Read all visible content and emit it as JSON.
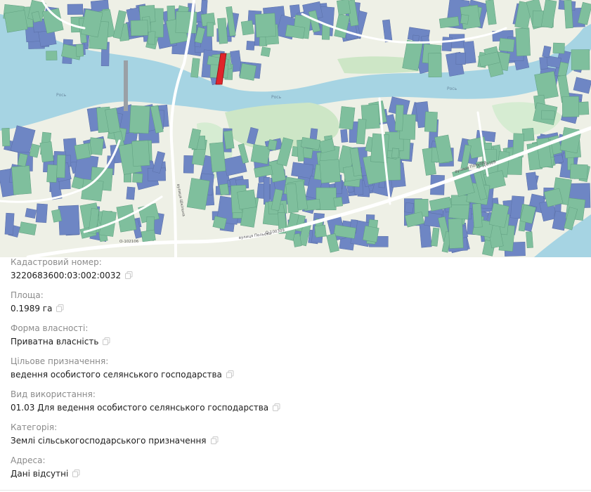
{
  "map": {
    "river_labels": [
      "Рось",
      "Рось",
      "Рось"
    ],
    "road_labels": [
      "О-102106",
      "вулиця Польова",
      "О-100309",
      "вулиця Польова",
      "О-100309",
      "вулиця Шкільна"
    ],
    "colors": {
      "water": "#a6d4e3",
      "land": "#eef0e6",
      "parcel_blue": "#6e86c4",
      "parcel_green": "#7fbf9d",
      "selected_parcel": "#e0242a",
      "park": "#cde6c6",
      "road": "#ffffff"
    }
  },
  "parcel": {
    "fields": [
      {
        "label": "Кадастровий номер:",
        "value": "3220683600:03:002:0032",
        "copy_icon": "copy-icon"
      },
      {
        "label": "Площа:",
        "value": "0.1989 га",
        "copy_icon": "copy-icon"
      },
      {
        "label": "Форма власності:",
        "value": "Приватна власність",
        "copy_icon": "copy-icon"
      },
      {
        "label": "Цільове призначення:",
        "value": "ведення особистого селянського господарства",
        "copy_icon": "copy-icon"
      },
      {
        "label": "Вид використання:",
        "value": "01.03 Для ведення особистого селянського господарства",
        "copy_icon": "copy-icon"
      },
      {
        "label": "Категорія:",
        "value": "Землі сільськогосподарського призначення",
        "copy_icon": "copy-icon"
      },
      {
        "label": "Адреса:",
        "value": "Дані відсутні",
        "copy_icon": "copy-icon"
      }
    ]
  }
}
